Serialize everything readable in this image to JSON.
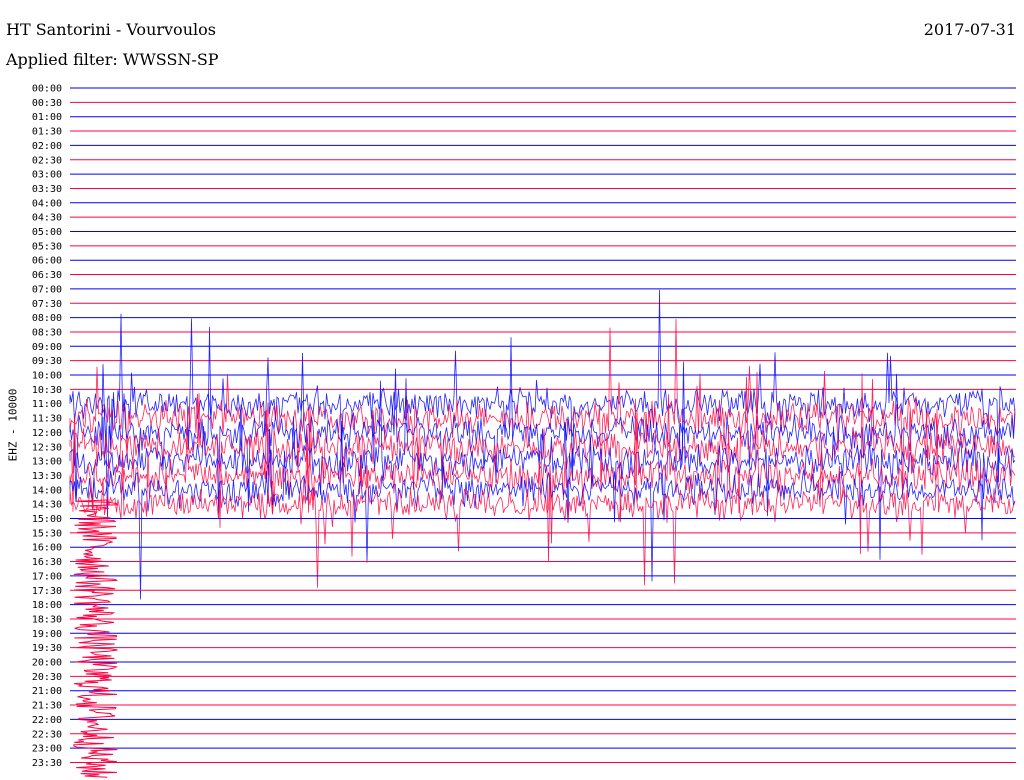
{
  "header": {
    "station": "HT Santorini - Vourvoulos",
    "date": "2017-07-31",
    "filter": "Applied filter: WWSSN-SP",
    "channel": "EHZ - 10000"
  },
  "colors": {
    "trace_a": "#0000ff",
    "trace_b": "#ff0040",
    "background": "#ffffff",
    "text": "#000000"
  },
  "chart_data": {
    "type": "line",
    "title": "HT Santorini - Vourvoulos",
    "ylabel": "EHZ - 10000",
    "xlabel": "",
    "row_interval_minutes": 30,
    "row_labels": [
      "00:00",
      "00:30",
      "01:00",
      "01:30",
      "02:00",
      "02:30",
      "03:00",
      "03:30",
      "04:00",
      "04:30",
      "05:00",
      "05:30",
      "06:00",
      "06:30",
      "07:00",
      "07:30",
      "08:00",
      "08:30",
      "09:00",
      "09:30",
      "10:00",
      "10:30",
      "11:00",
      "11:30",
      "12:00",
      "12:30",
      "13:00",
      "13:30",
      "14:00",
      "14:30",
      "15:00",
      "15:30",
      "16:00",
      "16:30",
      "17:00",
      "17:30",
      "18:00",
      "18:30",
      "19:00",
      "19:30",
      "20:00",
      "20:30",
      "21:00",
      "21:30",
      "22:00",
      "22:30",
      "23:00",
      "23:30"
    ],
    "row_colors": [
      "blue",
      "red"
    ],
    "signal_rows": [
      22,
      23,
      24,
      25,
      26,
      27,
      28,
      29
    ],
    "grid": false,
    "legend": "none"
  }
}
